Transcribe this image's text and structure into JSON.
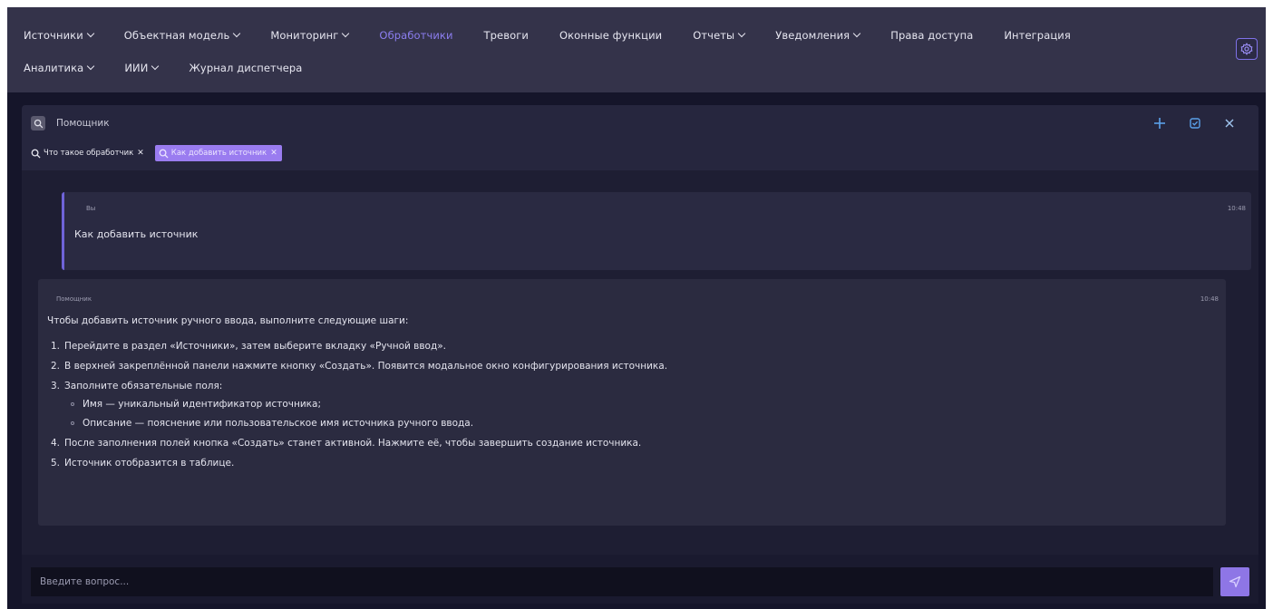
{
  "nav": {
    "row1": [
      {
        "label": "Источники",
        "dropdown": true,
        "active": false
      },
      {
        "label": "Объектная модель",
        "dropdown": true,
        "active": false
      },
      {
        "label": "Мониторинг",
        "dropdown": true,
        "active": false
      },
      {
        "label": "Обработчики",
        "dropdown": false,
        "active": true
      },
      {
        "label": "Тревоги",
        "dropdown": false,
        "active": false
      },
      {
        "label": "Оконные функции",
        "dropdown": false,
        "active": false
      },
      {
        "label": "Отчеты",
        "dropdown": true,
        "active": false
      },
      {
        "label": "Уведомления",
        "dropdown": true,
        "active": false
      },
      {
        "label": "Права доступа",
        "dropdown": false,
        "active": false
      },
      {
        "label": "Интеграция",
        "dropdown": false,
        "active": false
      }
    ],
    "row2": [
      {
        "label": "Аналитика",
        "dropdown": true,
        "active": false
      },
      {
        "label": "ИИИ",
        "dropdown": true,
        "active": false
      },
      {
        "label": "Журнал диспетчера",
        "dropdown": false,
        "active": false
      }
    ],
    "settings_icon": "gear-icon"
  },
  "assistant": {
    "title": "Помощник",
    "chips": [
      {
        "label": "Что такое обработчик",
        "active": false
      },
      {
        "label": "Как добавить источник",
        "active": true
      }
    ],
    "messages": {
      "user": {
        "author": "Вы",
        "time": "10:48",
        "text": "Как добавить источник"
      },
      "bot": {
        "author": "Помощник",
        "time": "10:48",
        "intro": "Чтобы добавить источник ручного ввода, выполните следующие шаги:",
        "steps": [
          {
            "num": "1.",
            "text": "Перейдите в раздел «Источники», затем выберите вкладку «Ручной ввод»."
          },
          {
            "num": "2.",
            "text": "В верхней закреплённой панели нажмите кнопку «Создать». Появится модальное окно конфигурирования источника."
          },
          {
            "num": "3.",
            "text": "Заполните обязательные поля:"
          },
          {
            "num": "4.",
            "text": "После заполнения полей кнопка «Создать» станет активной. Нажмите её, чтобы завершить создание источника."
          },
          {
            "num": "5.",
            "text": "Источник отобразится в таблице."
          }
        ],
        "step3_subitems": [
          "Имя — уникальный идентификатор источника;",
          "Описание — пояснение или пользовательское имя источника ручного ввода."
        ]
      }
    },
    "input": {
      "placeholder": "Введите вопрос...",
      "value": ""
    }
  },
  "colors": {
    "accent": "#8c7ef0",
    "nav_bg": "#34334a",
    "panel_bg": "#1e1e33",
    "page_bg": "#15152a",
    "chip_active": "#9a7cf0",
    "send_button": "#8e76e6"
  }
}
